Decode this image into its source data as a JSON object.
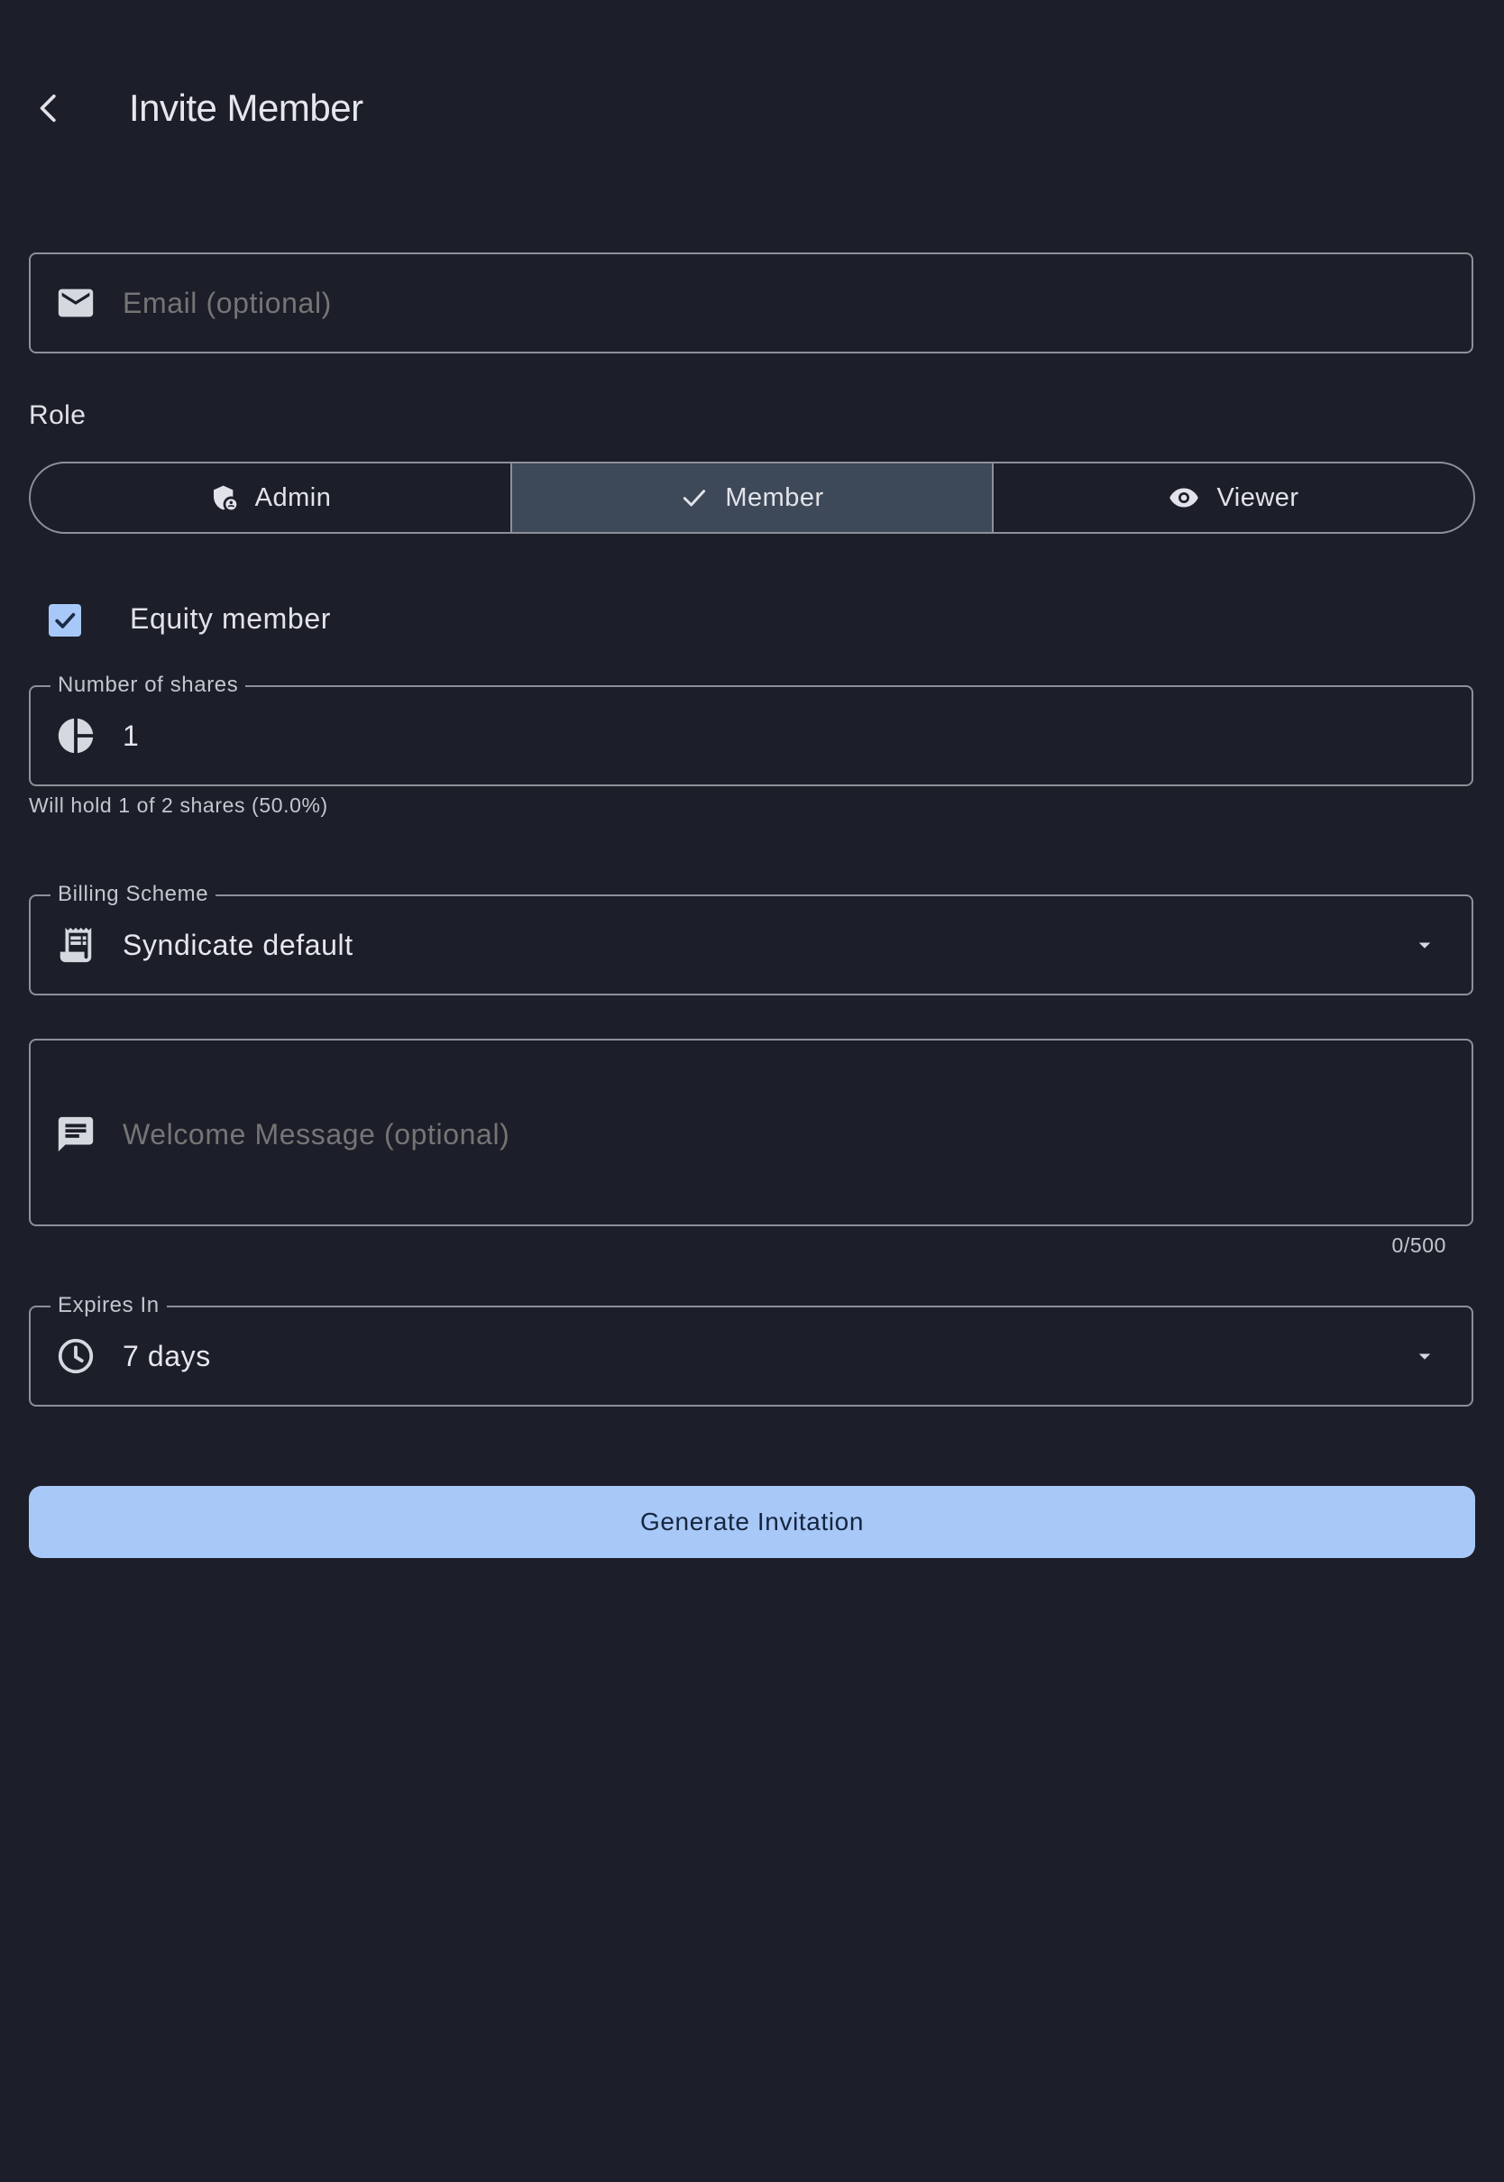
{
  "header": {
    "title": "Invite Member",
    "back_icon": "chevron-left-icon"
  },
  "email": {
    "placeholder": "Email (optional)",
    "value": "",
    "icon": "mail-icon"
  },
  "role": {
    "label": "Role",
    "options": [
      {
        "label": "Admin",
        "icon": "shield-person-icon",
        "selected": false
      },
      {
        "label": "Member",
        "icon": "check-icon",
        "selected": true
      },
      {
        "label": "Viewer",
        "icon": "eye-icon",
        "selected": false
      }
    ]
  },
  "equity": {
    "label": "Equity member",
    "checked": true
  },
  "shares": {
    "label": "Number of shares",
    "value": "1",
    "icon": "pie-chart-icon",
    "helper": "Will hold 1 of 2 shares (50.0%)"
  },
  "billing": {
    "label": "Billing Scheme",
    "value": "Syndicate default",
    "icon": "receipt-icon"
  },
  "welcome": {
    "placeholder": "Welcome Message (optional)",
    "value": "",
    "icon": "message-icon",
    "counter": "0/500"
  },
  "expires": {
    "label": "Expires In",
    "value": "7 days",
    "icon": "clock-icon"
  },
  "submit": {
    "label": "Generate Invitation"
  },
  "colors": {
    "background": "#1c1f29",
    "outline": "#8e9099",
    "primary": "#a8c8f8",
    "selected_segment": "#3d4858",
    "on_primary": "#15253f"
  }
}
